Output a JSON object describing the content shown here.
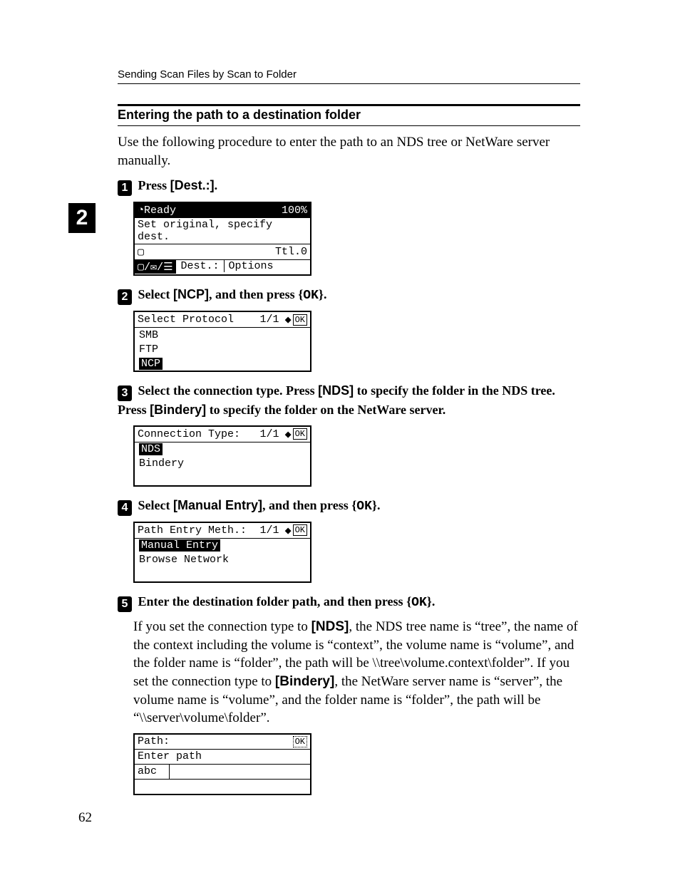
{
  "runningHead": "Sending Scan Files by Scan to Folder",
  "chapterTab": "2",
  "subhead": "Entering the path to a destination folder",
  "intro": "Use the following procedure to enter the path to an NDS tree or NetWare server manually.",
  "pageNumber": "62",
  "step1": {
    "num": "1",
    "pre": "Press ",
    "btn": "[Dest.:]",
    "post": "."
  },
  "lcd1": {
    "readyLabel": "Ready",
    "percent": "100%",
    "line2": "Set original, specify dest.",
    "folderGlyph": "▢",
    "ttl": "Ttl.0",
    "iconsGlyph": "▢/✉/☰",
    "tabDest": "Dest.:",
    "tabOptions": "Options"
  },
  "step2": {
    "num": "2",
    "pre": "Select ",
    "btn": "[NCP]",
    "mid": ", and then press ",
    "key": "OK",
    "post": "."
  },
  "lcd2": {
    "title": "Select Protocol",
    "page": "1/1",
    "arrows": "◆",
    "ok": "OK",
    "items": [
      "SMB",
      "FTP",
      "NCP"
    ],
    "selectedIndex": 2
  },
  "step3": {
    "num": "3",
    "t1": "Select the connection type. Press ",
    "btnA": "[NDS]",
    "t2": " to specify the folder in the NDS tree. Press ",
    "btnB": "[Bindery]",
    "t3": " to specify the folder on the NetWare server."
  },
  "lcd3": {
    "title": "Connection Type:",
    "page": "1/1",
    "arrows": "◆",
    "ok": "OK",
    "items": [
      "NDS",
      "Bindery"
    ],
    "selectedIndex": 0
  },
  "step4": {
    "num": "4",
    "pre": "Select ",
    "btn": "[Manual Entry]",
    "mid": ", and then press ",
    "key": "OK",
    "post": "."
  },
  "lcd4": {
    "title": "Path Entry Meth.:",
    "page": "1/1",
    "arrows": "◆",
    "ok": "OK",
    "items": [
      "Manual Entry",
      "Browse Network"
    ],
    "selectedIndex": 0
  },
  "step5": {
    "num": "5",
    "pre": "Enter the destination folder path, and then press ",
    "key": "OK",
    "post": "."
  },
  "step5Body": {
    "t1": "If you set the connection type to ",
    "btnA": "[NDS]",
    "t2": ", the NDS tree name is “tree”, the name of the context including the volume is “context”, the volume name is “volume”, and the folder name is “folder”, the path will be \\\\tree\\volume.context\\folder”. If you set the connection type to ",
    "btnB": "[Bindery]",
    "t3": ", the NetWare server name is “server”, the volume name is “volume”, and the folder name is “folder”, the path will be “\\\\server\\volume\\folder”."
  },
  "lcd5": {
    "title": "Path:",
    "ok": "OK",
    "line2": "Enter path",
    "mode": "abc"
  }
}
